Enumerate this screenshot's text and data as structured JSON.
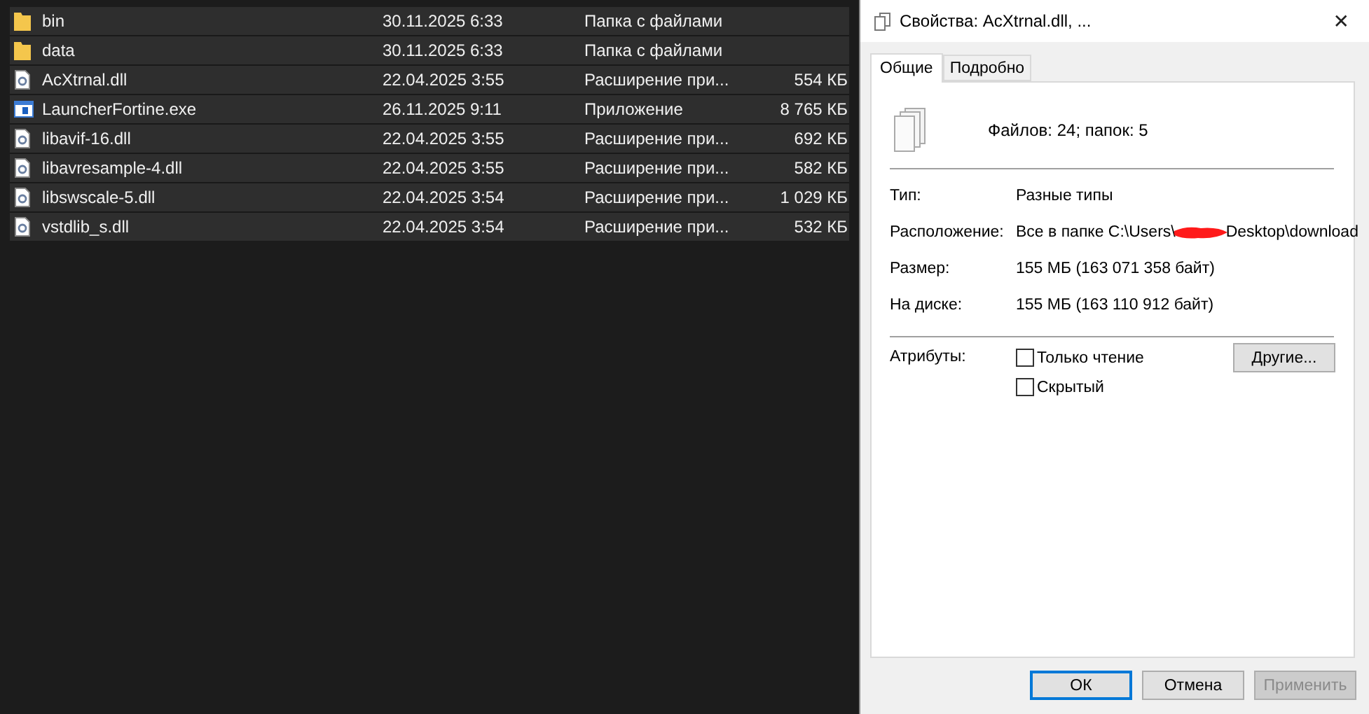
{
  "files": [
    {
      "kind": "folder",
      "name": "bin",
      "date": "30.11.2025 6:33",
      "type": "Папка с файлами",
      "selected": true
    },
    {
      "kind": "folder",
      "name": "data",
      "date": "30.11.2025 6:33",
      "type": "Папка с файлами",
      "selected": true
    },
    {
      "kind": "dll",
      "name": "AcXtrnal.dll",
      "date": "22.04.2025 3:55",
      "type": "Расширение при...",
      "size": "554 КБ",
      "selected": true
    },
    {
      "kind": "exe",
      "name": "LauncherFortine.exe",
      "date": "26.11.2025 9:11",
      "type": "Приложение",
      "size": "8 765 КБ",
      "selected": true
    },
    {
      "kind": "dll",
      "name": "libavif-16.dll",
      "date": "22.04.2025 3:55",
      "type": "Расширение при...",
      "size": "692 КБ",
      "selected": true
    },
    {
      "kind": "dll",
      "name": "libavresample-4.dll",
      "date": "22.04.2025 3:55",
      "type": "Расширение при...",
      "size": "582 КБ",
      "selected": true
    },
    {
      "kind": "dll",
      "name": "libswscale-5.dll",
      "date": "22.04.2025 3:54",
      "type": "Расширение при...",
      "size": "1 029 КБ",
      "selected": true
    },
    {
      "kind": "dll",
      "name": "vstdlib_s.dll",
      "date": "22.04.2025 3:54",
      "type": "Расширение при...",
      "size": "532 КБ",
      "selected": true
    }
  ],
  "dialog": {
    "title": "Свойства: AcXtrnal.dll, ...",
    "close": "✕",
    "tabs": [
      {
        "label": "Общие",
        "selected": true
      },
      {
        "label": "Подробно",
        "selected": false
      }
    ],
    "summary": "Файлов: 24; папок: 5",
    "type": {
      "label": "Тип:",
      "value": "Разные типы"
    },
    "location": {
      "label": "Расположение:",
      "value_start": "Все в папке C:\\Users\\",
      "redacted": true,
      "value_end": "Desktop\\download"
    },
    "size": {
      "label": "Размер:",
      "value": "155 МБ (163 071 358 байт)"
    },
    "on_disk": {
      "label": "На диске:",
      "value": "155 МБ (163 110 912 байт)"
    },
    "attributes": {
      "label": "Атрибуты:",
      "options": [
        {
          "label": "Только чтение",
          "checked": false
        },
        {
          "label": "Скрытый",
          "checked": false
        }
      ],
      "other_button": "Другие..."
    },
    "buttons": [
      {
        "label": "ОК",
        "default": true,
        "disabled": false
      },
      {
        "label": "Отмена",
        "default": false,
        "disabled": false
      },
      {
        "label": "Применить",
        "default": false,
        "disabled": true
      }
    ]
  }
}
